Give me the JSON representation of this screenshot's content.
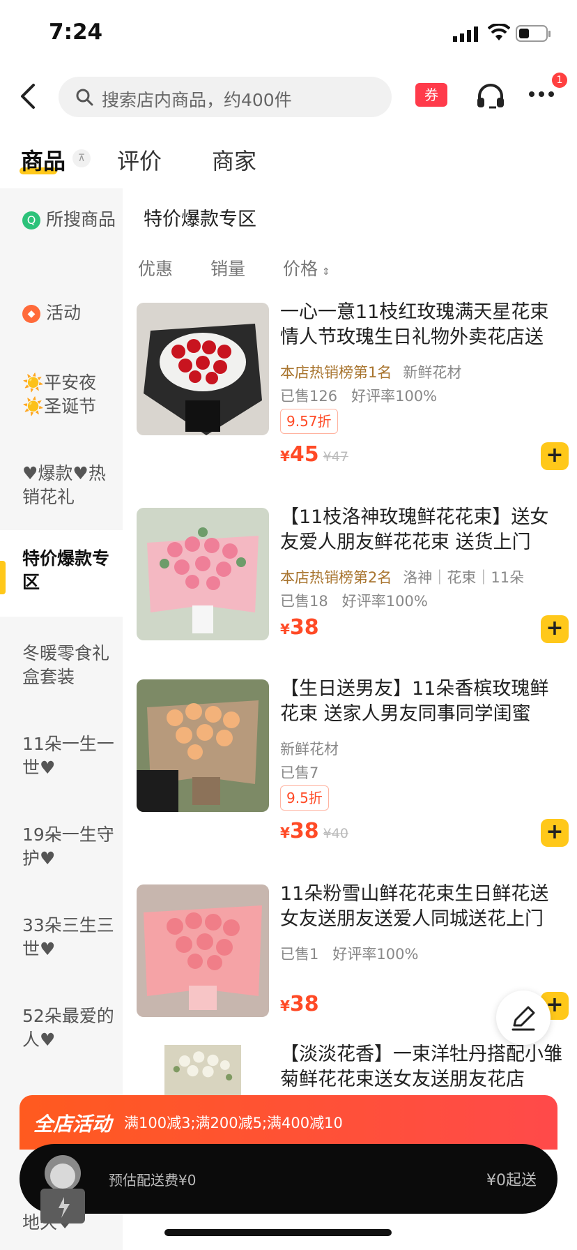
{
  "status": {
    "time": "7:24"
  },
  "search": {
    "placeholder": "搜索店内商品，约400件"
  },
  "header": {
    "coupon_label": "券",
    "notify_count": "1"
  },
  "tabs": [
    {
      "label": "商品"
    },
    {
      "label": "评价"
    },
    {
      "label": "商家"
    }
  ],
  "sidebar": {
    "items": [
      {
        "label": "所搜商品"
      },
      {
        "label": "活动"
      },
      {
        "label": "☀️平安夜☀️圣诞节"
      },
      {
        "label": "♥爆款♥热销花礼"
      },
      {
        "label": "特价爆款专区"
      },
      {
        "label": "冬暖零食礼盒套装"
      },
      {
        "label": "11朵一生一世♥"
      },
      {
        "label": "19朵一生守护♥"
      },
      {
        "label": "33朵三生三世♥"
      },
      {
        "label": "52朵最爱的人♥"
      },
      {
        "label": "地久♥"
      }
    ]
  },
  "section": {
    "title": "特价爆款专区",
    "filters": [
      "优惠",
      "销量",
      "价格"
    ]
  },
  "products": [
    {
      "name": "一心一意11枝红玫瑰满天星花束情人节玫瑰生日礼物外卖花店送",
      "rank": "本店热销榜第1名",
      "tags": "新鲜花材",
      "sold": "已售126",
      "rating": "好评率100%",
      "discount": "9.57折",
      "price": "45",
      "orig": "¥47"
    },
    {
      "name": "【11枝洛神玫瑰鲜花花束】送女友爱人朋友鲜花花束 送货上门",
      "rank": "本店热销榜第2名",
      "tags": "洛神｜花束｜11朵",
      "sold": "已售18",
      "rating": "好评率100%",
      "price": "38"
    },
    {
      "name": "【生日送男友】11朵香槟玫瑰鲜花束 送家人男友同事同学闺蜜",
      "tags": "新鲜花材",
      "sold": "已售7",
      "discount": "9.5折",
      "price": "38",
      "orig": "¥40"
    },
    {
      "name": "11朵粉雪山鲜花花束生日鲜花送女友送朋友送爱人同城送花上门",
      "sold": "已售1",
      "rating": "好评率100%",
      "price": "38"
    },
    {
      "name": "【淡淡花香】一束洋牡丹搭配小雏菊鲜花花束送女友送朋友花店"
    }
  ],
  "promo": {
    "label": "全店活动",
    "rules": "满100减3;满200减5;满400减10"
  },
  "cart": {
    "fee": "预估配送费¥0",
    "min": "¥0起送"
  },
  "yen": "¥",
  "colors": {
    "accent": "#ffc81a",
    "price": "#ff4a26",
    "promo": "#ff5a1f"
  }
}
